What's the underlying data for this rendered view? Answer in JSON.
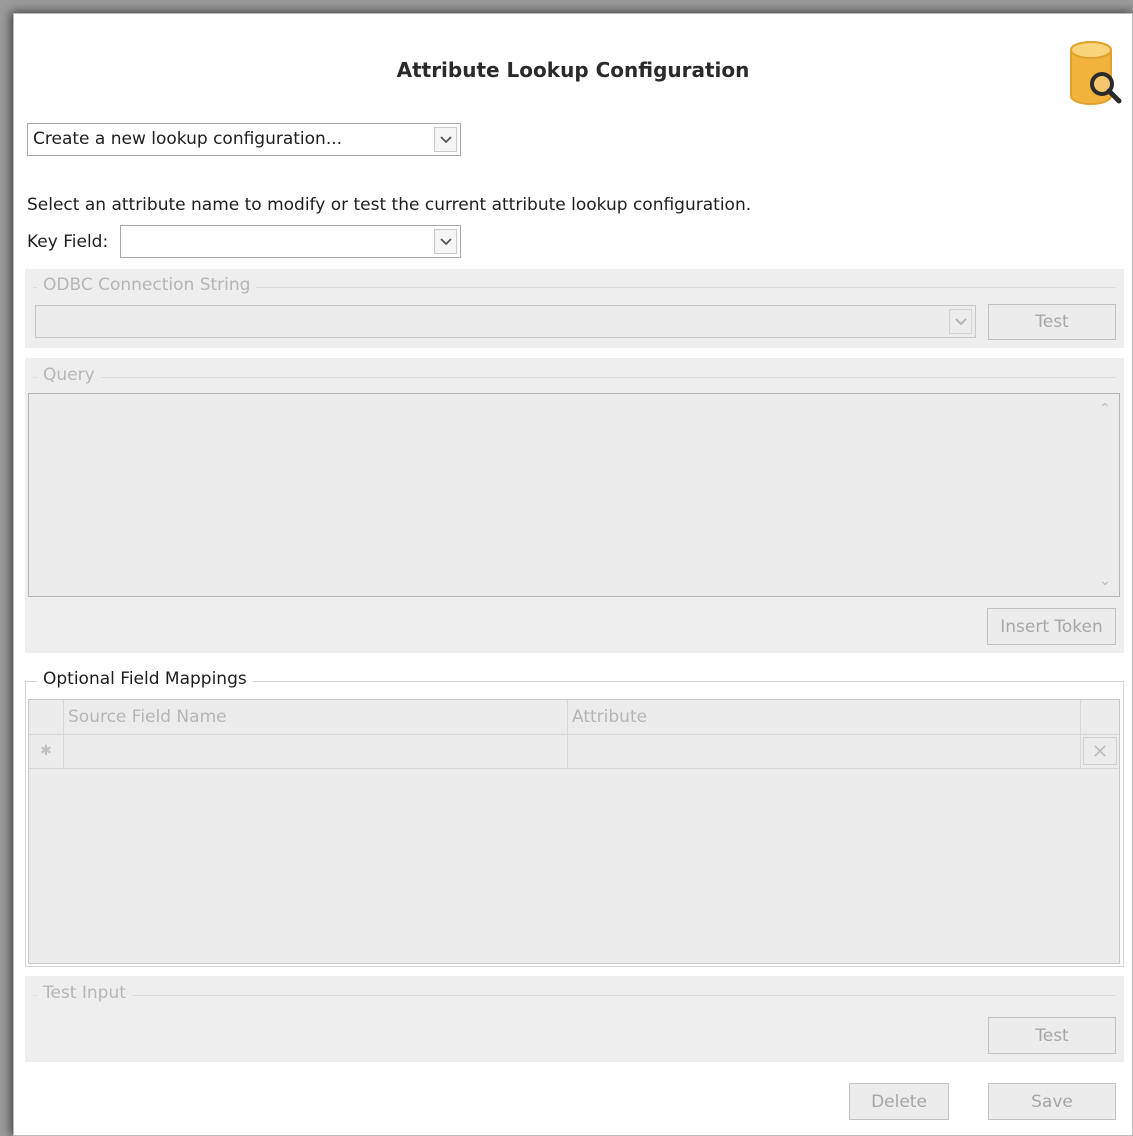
{
  "dialog": {
    "title": "Attribute Lookup Configuration",
    "logo_icon": "database-search-icon"
  },
  "config_select": {
    "value": "Create a new lookup configuration...",
    "arrow_icon": "chevron-down-icon"
  },
  "instructions": "Select an attribute name to modify or test the current attribute lookup configuration.",
  "key_field": {
    "label": "Key Field:",
    "value": ""
  },
  "odbc": {
    "legend": "ODBC Connection String",
    "value": "",
    "test_label": "Test"
  },
  "query": {
    "legend": "Query",
    "value": "",
    "insert_token_label": "Insert Token"
  },
  "mappings": {
    "legend": "Optional Field Mappings",
    "columns": [
      "Source Field Name",
      "Attribute"
    ],
    "new_row_icon": "new-row-asterisk-icon",
    "delete_row_icon": "close-icon"
  },
  "test_input": {
    "legend": "Test Input",
    "test_label": "Test"
  },
  "footer": {
    "delete_label": "Delete",
    "save_label": "Save"
  },
  "colors": {
    "logo_gold": "#f2b33d",
    "disabled_bg": "#eeeeee",
    "disabled_text": "#b5b5b5"
  }
}
